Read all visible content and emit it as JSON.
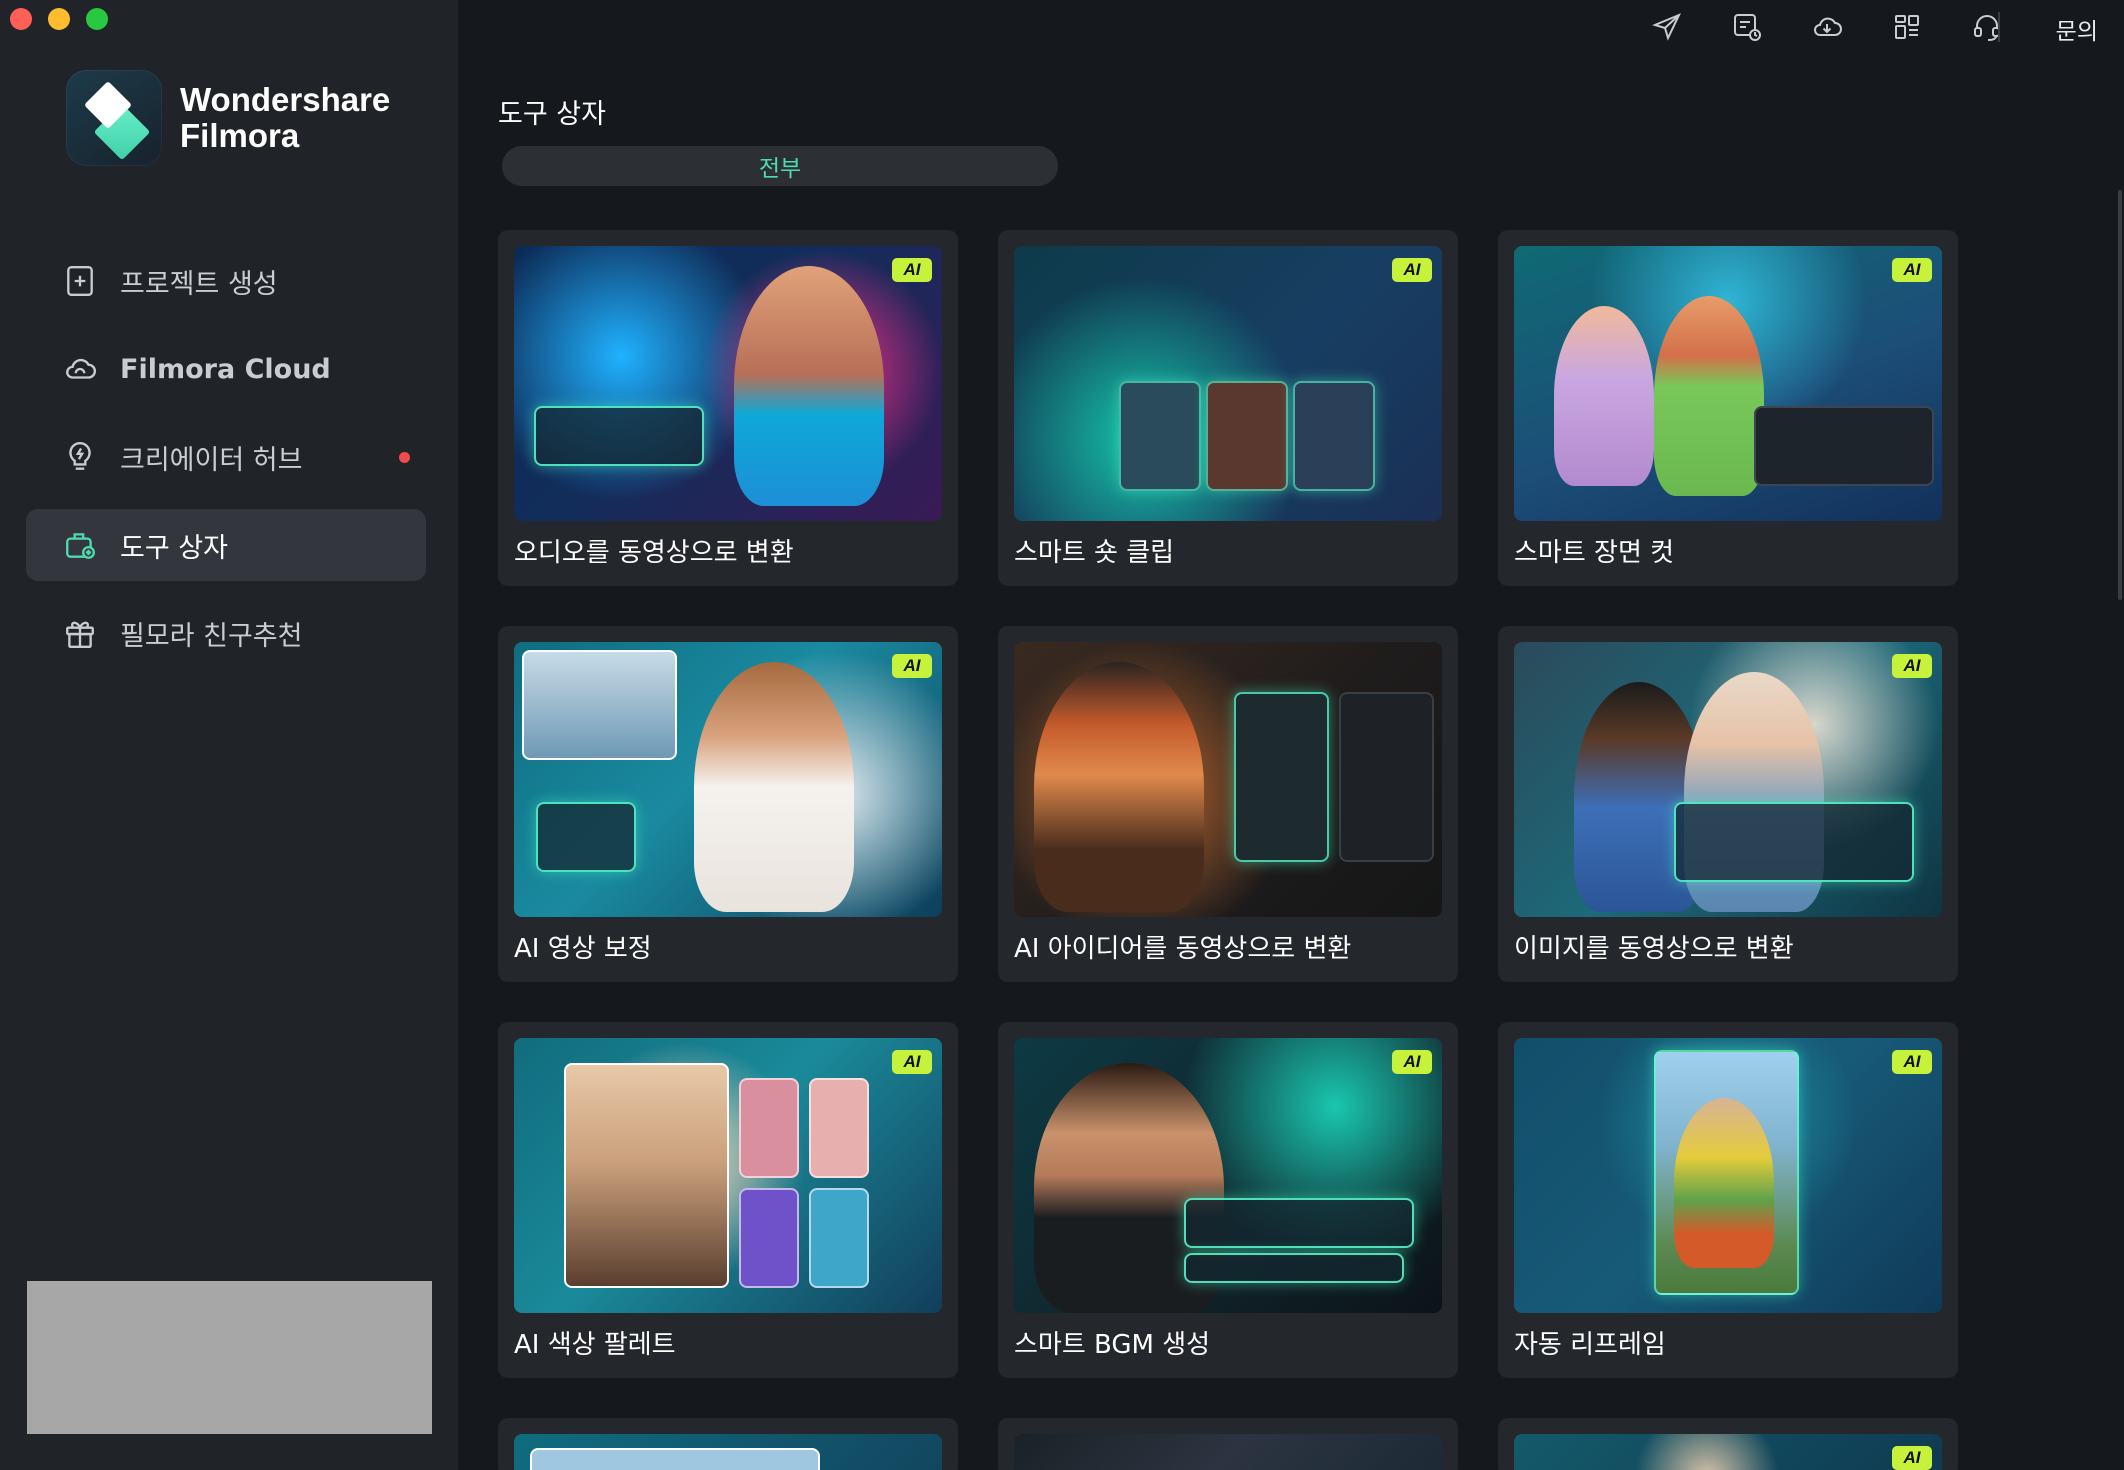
{
  "window": {
    "controls": [
      "close",
      "minimize",
      "zoom"
    ]
  },
  "brand": {
    "line1": "Wondershare",
    "line2": "Filmora"
  },
  "sidebar": {
    "items": [
      {
        "label": "프로젝트 생성",
        "icon": "new-project-icon",
        "active": false
      },
      {
        "label": "Filmora Cloud",
        "icon": "cloud-icon",
        "active": false
      },
      {
        "label": "크리에이터 허브",
        "icon": "lightbulb-icon",
        "active": false,
        "notification": true
      },
      {
        "label": "도구 상자",
        "icon": "toolbox-icon",
        "active": true
      },
      {
        "label": "필모라 친구추천",
        "icon": "gift-icon",
        "active": false
      }
    ]
  },
  "topbar": {
    "icons": [
      "send-icon",
      "feedback-icon",
      "cloud-download-icon",
      "apps-grid-icon",
      "support-headset-icon"
    ],
    "inquiry_label": "문의"
  },
  "main": {
    "title": "도구 상자",
    "filter": {
      "selected": "전부"
    },
    "tools": [
      {
        "label": "오디오를 동영상으로 변환",
        "ai": true
      },
      {
        "label": "스마트 숏 클립",
        "ai": true
      },
      {
        "label": "스마트 장면 컷",
        "ai": true
      },
      {
        "label": "AI 영상 보정",
        "ai": true
      },
      {
        "label": "AI 아이디어를 동영상으로 변환",
        "ai": false
      },
      {
        "label": "이미지를 동영상으로 변환",
        "ai": true
      },
      {
        "label": "AI 색상 팔레트",
        "ai": true
      },
      {
        "label": "스마트 BGM 생성",
        "ai": true
      },
      {
        "label": "자동 리프레임",
        "ai": true
      }
    ],
    "partial_row_ai": [
      false,
      false,
      true
    ],
    "ai_badge_text": "AI"
  },
  "colors": {
    "accent": "#4fdbb0",
    "ai_badge": "#c6f23b",
    "notification": "#f24b4b"
  }
}
